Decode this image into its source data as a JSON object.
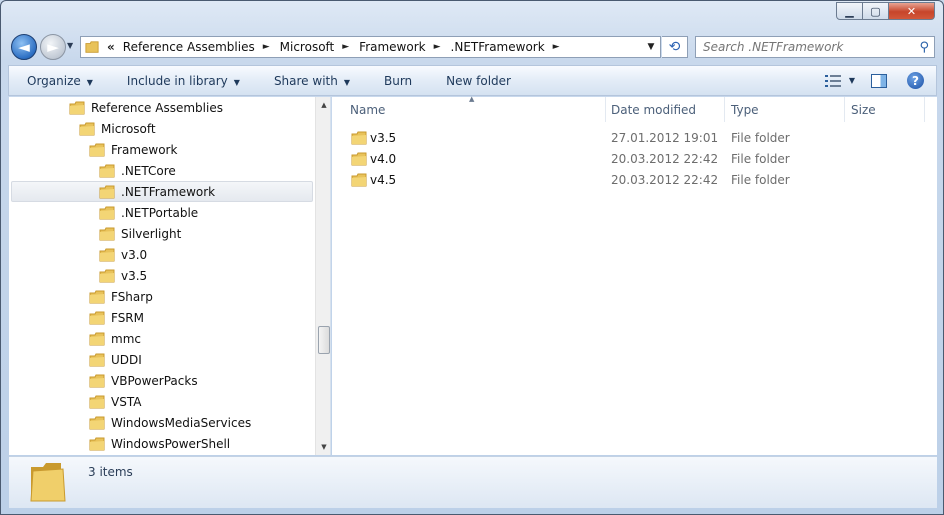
{
  "window": {
    "caption_buttons": {
      "minimize": "▁",
      "maximize": "▢",
      "close": "✕"
    }
  },
  "nav": {
    "back_icon": "◄",
    "forward_icon": "►",
    "recent_icon": "▼",
    "address": {
      "overflow": "«",
      "crumbs": [
        "Reference Assemblies",
        "Microsoft",
        "Framework",
        ".NETFramework"
      ],
      "separator": "►",
      "dropdown": "▼"
    },
    "refresh_icon": "⟲",
    "search": {
      "placeholder": "Search .NETFramework",
      "icon": "⚲"
    }
  },
  "commandbar": {
    "items": [
      {
        "label": "Organize",
        "arrow": "▼"
      },
      {
        "label": "Include in library",
        "arrow": "▼"
      },
      {
        "label": "Share with",
        "arrow": "▼"
      },
      {
        "label": "Burn",
        "arrow": ""
      },
      {
        "label": "New folder",
        "arrow": ""
      }
    ],
    "view_arrow": "▼",
    "help": "?"
  },
  "navpane": {
    "items": [
      {
        "label": "Reference Assemblies",
        "level": 0
      },
      {
        "label": "Microsoft",
        "level": 1
      },
      {
        "label": "Framework",
        "level": 2
      },
      {
        "label": ".NETCore",
        "level": 3
      },
      {
        "label": ".NETFramework",
        "level": 3,
        "selected": true
      },
      {
        "label": ".NETPortable",
        "level": 3
      },
      {
        "label": "Silverlight",
        "level": 3
      },
      {
        "label": "v3.0",
        "level": 3
      },
      {
        "label": "v3.5",
        "level": 3
      },
      {
        "label": "FSharp",
        "level": 2
      },
      {
        "label": "FSRM",
        "level": 2
      },
      {
        "label": "mmc",
        "level": 2
      },
      {
        "label": "UDDI",
        "level": 2
      },
      {
        "label": "VBPowerPacks",
        "level": 2
      },
      {
        "label": "VSTA",
        "level": 2
      },
      {
        "label": "WindowsMediaServices",
        "level": 2
      },
      {
        "label": "WindowsPowerShell",
        "level": 2
      }
    ],
    "scroll_up": "▲",
    "scroll_down": "▼"
  },
  "content": {
    "columns": {
      "name": "Name",
      "date": "Date modified",
      "type": "Type",
      "size": "Size",
      "sort_arrow": "▲"
    },
    "rows": [
      {
        "name": "v3.5",
        "date": "27.01.2012 19:01",
        "type": "File folder"
      },
      {
        "name": "v4.0",
        "date": "20.03.2012 22:42",
        "type": "File folder"
      },
      {
        "name": "v4.5",
        "date": "20.03.2012 22:42",
        "type": "File folder"
      }
    ]
  },
  "details": {
    "count": "3 items"
  },
  "colors": {
    "folder": "#e8c25a",
    "folder_dark": "#c99a2e",
    "accent": "#1e395b"
  }
}
